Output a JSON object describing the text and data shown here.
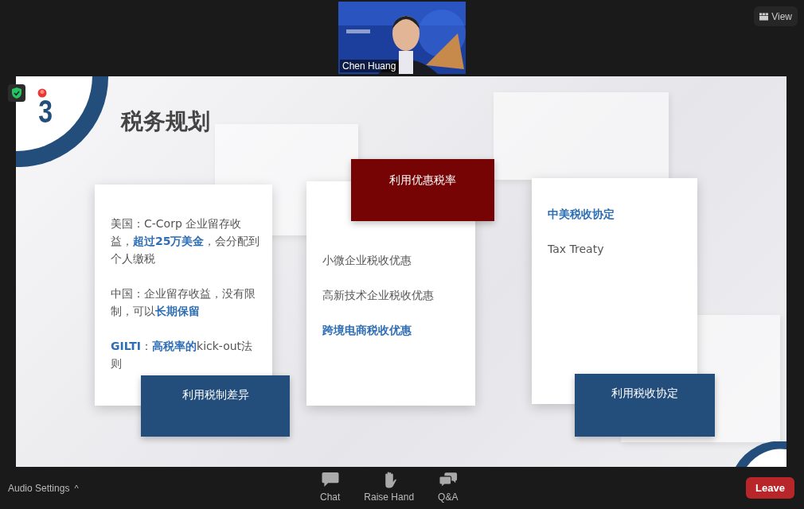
{
  "top_bar": {
    "view_button": "View"
  },
  "video": {
    "participant": "Chen Huang"
  },
  "slide": {
    "section_number": "3",
    "title": "税务规划",
    "cards": [
      {
        "label": "利用税制差异",
        "kind": "bottom",
        "color": "#234e7c",
        "items": [
          {
            "text": "美国：C-Corp  企业留存收益，**超过25万美金**，会分配到个人缴税",
            "emphasis": false
          },
          {
            "text": "中国：企业留存收益，没有限制，可以**长期保留**",
            "emphasis": false
          },
          {
            "text": "**GILTI**：**高税率的**kick-out法则",
            "emphasis": false
          }
        ]
      },
      {
        "label": "利用优惠税率",
        "kind": "top",
        "color": "#760404",
        "items": [
          {
            "text": "小微企业税收优惠",
            "emphasis": false
          },
          {
            "text": "高新技术企业税收优惠",
            "emphasis": false
          },
          {
            "text": "跨境电商税收优惠",
            "emphasis": true
          }
        ]
      },
      {
        "label": "利用税收协定",
        "kind": "bottom",
        "color": "#234e7c",
        "items": [
          {
            "text": "中美税收协定",
            "emphasis": true
          },
          {
            "text": "Tax Treaty",
            "emphasis": false
          }
        ]
      }
    ]
  },
  "toolbar": {
    "audio_settings": "Audio Settings",
    "caret": "^",
    "buttons": [
      {
        "kind": "chat",
        "label": "Chat"
      },
      {
        "kind": "hand",
        "label": "Raise Hand"
      },
      {
        "kind": "qa",
        "label": "Q&A"
      }
    ],
    "leave": "Leave"
  }
}
